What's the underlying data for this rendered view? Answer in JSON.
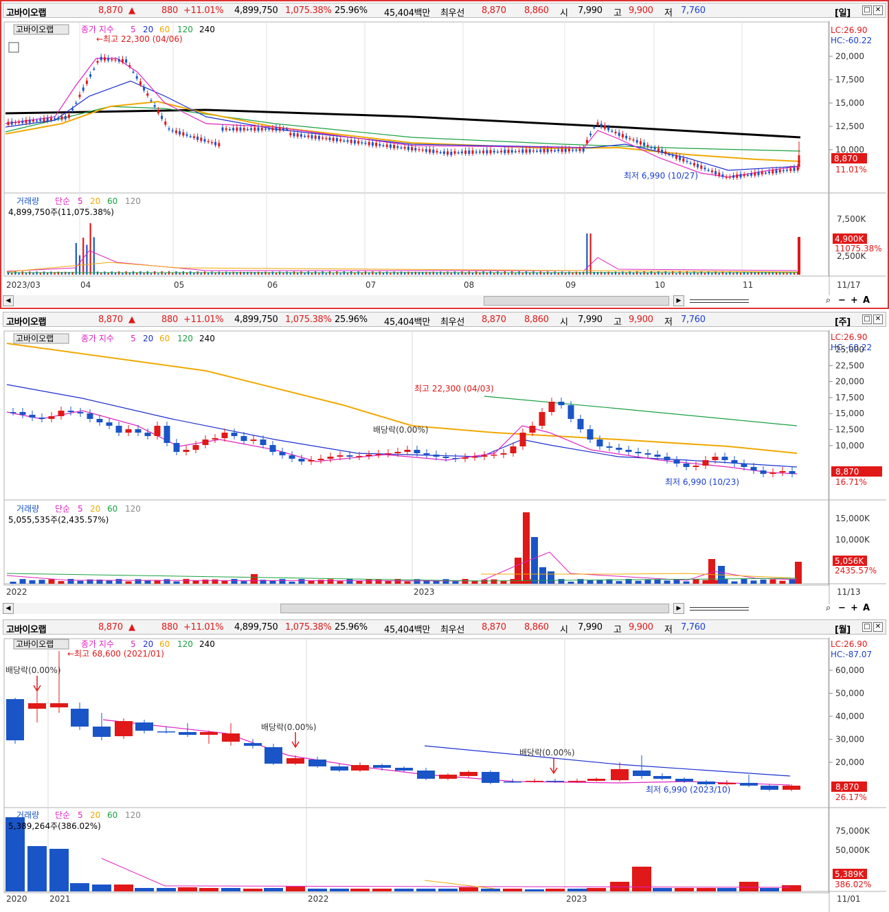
{
  "quote": {
    "name": "고바이오랩",
    "price": "8,870",
    "up_mark": "▲",
    "change": "880",
    "change_pct": "+11.01%",
    "volume": "4,899,750",
    "volume_pct": "1,075.38%",
    "turnover": "25.96%",
    "amount": "45,404백만",
    "bid_label": "최우선",
    "bid1": "8,870",
    "bid2": "8,860",
    "open_label": "시",
    "open": "7,990",
    "high_label": "고",
    "high": "9,900",
    "low_label": "저",
    "low": "7,760"
  },
  "panels": [
    {
      "period": "[일]",
      "legend": {
        "name": "고바이오랩",
        "type": "종가 지수",
        "ma5": "5",
        "ma20": "20",
        "ma60": "60",
        "ma120": "120",
        "ma240": "240"
      },
      "lc": "LC:26.90",
      "hc": "HC:-60.22",
      "hi_note": "←최고 22,300 (04/06)",
      "lo_note": "최저 6,990 (10/27)",
      "price_labels": [
        "20,000",
        "17,500",
        "15,000",
        "12,500",
        "10,000"
      ],
      "cur_label": "8,870",
      "cur_pct": "11.01%",
      "vol_legend": {
        "name": "거래량",
        "type": "단순",
        "ma5": "5",
        "ma20": "20",
        "ma60": "60",
        "ma120": "120"
      },
      "vol_info": "4,899,750주(11,075.38%)",
      "vol_labels": [
        "7,500K",
        "2,500K"
      ],
      "vol_cur": "4,900K",
      "vol_pct": "11075.38%",
      "dates": [
        "2023/03",
        "04",
        "05",
        "06",
        "07",
        "08",
        "09",
        "10",
        "11"
      ],
      "last_date": "11/17"
    },
    {
      "period": "[주]",
      "legend": {
        "name": "고바이오랩",
        "type": "종가 지수",
        "ma5": "5",
        "ma20": "20",
        "ma60": "60",
        "ma120": "120",
        "ma240": "240"
      },
      "lc": "LC:26.90",
      "hc": "HC:-60.22",
      "hi_note": "최고 22,300 (04/03)",
      "lo_note": "최저 6,990 (10/23)",
      "div_note": "배당락(0.00%)",
      "price_labels": [
        "25,000",
        "22,500",
        "20,000",
        "17,500",
        "15,000",
        "12,500",
        "10,000"
      ],
      "cur_label": "8,870",
      "cur_pct": "16.71%",
      "vol_legend": {
        "name": "거래량",
        "type": "단순",
        "ma5": "5",
        "ma20": "20",
        "ma60": "60",
        "ma120": "120"
      },
      "vol_info": "5,055,535주(2,435.57%)",
      "vol_labels": [
        "15,000K",
        "10,000K"
      ],
      "vol_cur": "5,056K",
      "vol_pct": "2435.57%",
      "dates": [
        "2022",
        "2023"
      ],
      "last_date": "11/13"
    },
    {
      "period": "[월]",
      "legend": {
        "name": "고바이오랩",
        "type": "종가 지수",
        "ma5": "5",
        "ma20": "20",
        "ma60": "60",
        "ma120": "120",
        "ma240": "240"
      },
      "lc": "LC:26.90",
      "hc": "HC:-87.07",
      "hi_note": "←최고 68,600 (2021/01)",
      "lo_note": "최저 6,990 (2023/10)",
      "div_note": "배당락(0.00%)",
      "price_labels": [
        "60,000",
        "50,000",
        "40,000",
        "30,000",
        "20,000"
      ],
      "cur_label": "8,870",
      "cur_pct": "26.17%",
      "vol_legend": {
        "name": "거래량",
        "type": "단순",
        "ma5": "5",
        "ma20": "20",
        "ma60": "60",
        "ma120": "120"
      },
      "vol_info": "5,389,264주(386.02%)",
      "vol_labels": [
        "75,000K",
        "50,000K"
      ],
      "vol_cur": "5,389K",
      "vol_pct": "386.02%",
      "dates": [
        "2020",
        "2021",
        "2022",
        "2023"
      ],
      "last_date": "11/01"
    }
  ],
  "colors": {
    "up": "#e01818",
    "down": "#1a55c8",
    "ma5": "#e020c0",
    "ma20": "#1a2fd0",
    "ma60": "#f0a800",
    "ma120": "#18a040",
    "ma240": "#000000"
  },
  "icons": [
    "calendar-icon",
    "zoom-icon",
    "minus-icon",
    "plus-icon",
    "text-icon"
  ]
}
